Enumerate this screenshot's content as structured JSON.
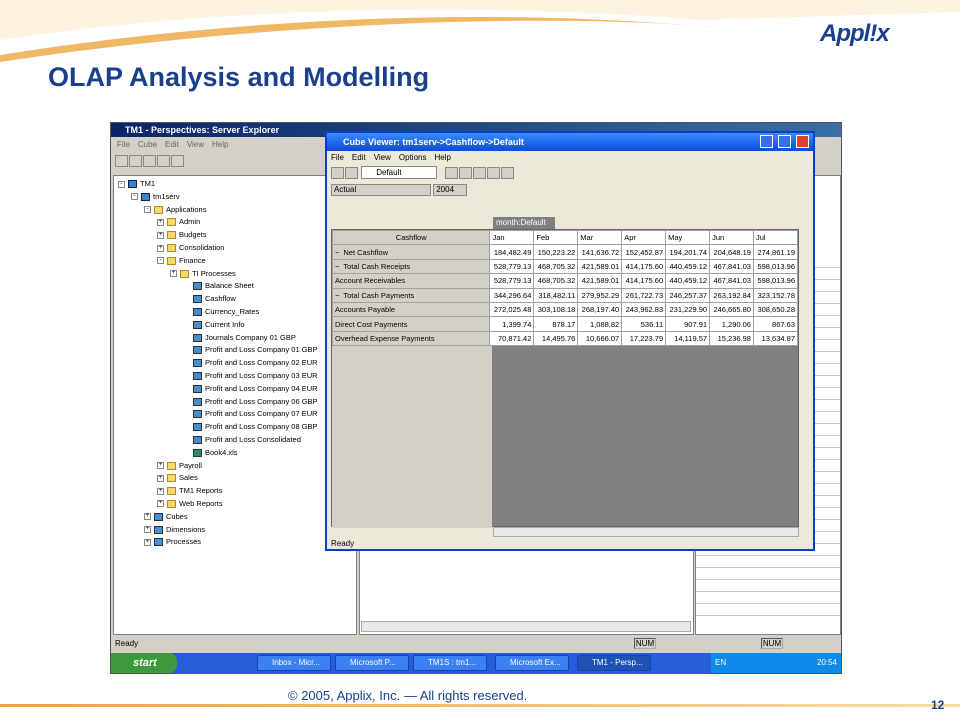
{
  "slide": {
    "title": "OLAP Analysis and Modelling",
    "logo": "Appl!x",
    "copyright": "© 2005, Applix, Inc. — All rights reserved.",
    "page": "12"
  },
  "explorer": {
    "title": "TM1 - Perspectives: Server Explorer",
    "menu": [
      "File",
      "Cube",
      "Edit",
      "View",
      "Help"
    ],
    "tree": [
      {
        "t": "TM1",
        "d": 0,
        "pm": "-",
        "ic": "srv"
      },
      {
        "t": "tm1serv",
        "d": 1,
        "pm": "-",
        "ic": "srv"
      },
      {
        "t": "Applications",
        "d": 2,
        "pm": "-",
        "ic": "folder"
      },
      {
        "t": "Admin",
        "d": 3,
        "pm": "+",
        "ic": "folder"
      },
      {
        "t": "Budgets",
        "d": 3,
        "pm": "+",
        "ic": "folder"
      },
      {
        "t": "Consolidation",
        "d": 3,
        "pm": "+",
        "ic": "folder"
      },
      {
        "t": "Finance",
        "d": 3,
        "pm": "-",
        "ic": "folder"
      },
      {
        "t": "TI Processes",
        "d": 4,
        "pm": "+",
        "ic": "folder"
      },
      {
        "t": "Balance Sheet",
        "d": 5,
        "pm": "",
        "ic": "cubei"
      },
      {
        "t": "Cashflow",
        "d": 5,
        "pm": "",
        "ic": "cubei"
      },
      {
        "t": "Currency_Rates",
        "d": 5,
        "pm": "",
        "ic": "cubei"
      },
      {
        "t": "Current Info",
        "d": 5,
        "pm": "",
        "ic": "cubei"
      },
      {
        "t": "Journals Company 01 GBP",
        "d": 5,
        "pm": "",
        "ic": "cubei"
      },
      {
        "t": "Profit and Loss Company 01 GBP",
        "d": 5,
        "pm": "",
        "ic": "cubei"
      },
      {
        "t": "Profit and Loss Company 02 EUR",
        "d": 5,
        "pm": "",
        "ic": "cubei"
      },
      {
        "t": "Profit and Loss Company 03 EUR",
        "d": 5,
        "pm": "",
        "ic": "cubei"
      },
      {
        "t": "Profit and Loss Company 04 EUR",
        "d": 5,
        "pm": "",
        "ic": "cubei"
      },
      {
        "t": "Profit and Loss Company 06 GBP",
        "d": 5,
        "pm": "",
        "ic": "cubei"
      },
      {
        "t": "Profit and Loss Company 07 EUR",
        "d": 5,
        "pm": "",
        "ic": "cubei"
      },
      {
        "t": "Profit and Loss Company 08 GBP",
        "d": 5,
        "pm": "",
        "ic": "cubei"
      },
      {
        "t": "Profit and Loss Consolidated",
        "d": 5,
        "pm": "",
        "ic": "cubei"
      },
      {
        "t": "Book4.xls",
        "d": 5,
        "pm": "",
        "ic": "xls"
      },
      {
        "t": "Payroll",
        "d": 3,
        "pm": "+",
        "ic": "folder"
      },
      {
        "t": "Sales",
        "d": 3,
        "pm": "+",
        "ic": "folder"
      },
      {
        "t": "TM1 Reports",
        "d": 3,
        "pm": "+",
        "ic": "folder"
      },
      {
        "t": "Web Reports",
        "d": 3,
        "pm": "+",
        "ic": "folder"
      },
      {
        "t": "Cubes",
        "d": 2,
        "pm": "+",
        "ic": "cubei"
      },
      {
        "t": "Dimensions",
        "d": 2,
        "pm": "+",
        "ic": "cubei"
      },
      {
        "t": "Processes",
        "d": 2,
        "pm": "+",
        "ic": "cubei"
      }
    ],
    "status": "Ready",
    "num": "NUM"
  },
  "viewer": {
    "title": "Cube Viewer:  tm1serv->Cashflow->Default",
    "menu": [
      "File",
      "Edit",
      "View",
      "Options",
      "Help"
    ],
    "view": "Default",
    "title_dims": [
      "Actual",
      "2004"
    ],
    "col_dim": "month:Default",
    "row_dim": "Cashflow",
    "months": [
      "Jan",
      "Feb",
      "Mar",
      "Apr",
      "May",
      "Jun",
      "Jul"
    ],
    "rows": [
      {
        "label": "Net Cashflow",
        "exp": "−",
        "v": [
          "184,482.49",
          "150,223.22",
          "141,636.72",
          "152,452.87",
          "194,201.74",
          "204,648.19",
          "274,861.19"
        ]
      },
      {
        "label": "Total Cash Receipts",
        "exp": "−",
        "v": [
          "528,779.13",
          "468,705.32",
          "421,589.01",
          "414,175.60",
          "440,459.12",
          "467,841.03",
          "598,013.96"
        ]
      },
      {
        "label": "Account Receivables",
        "exp": "",
        "v": [
          "528,779.13",
          "468,705.32",
          "421,589.01",
          "414,175.60",
          "440,459.12",
          "467,841.03",
          "598,013.96"
        ]
      },
      {
        "label": "Total Cash Payments",
        "exp": "−",
        "v": [
          "344,296.64",
          "318,482.11",
          "279,952.29",
          "261,722.73",
          "246,257.37",
          "263,192.84",
          "323,152.78"
        ]
      },
      {
        "label": "Accounts Payable",
        "exp": "",
        "v": [
          "272,025.48",
          "303,108.18",
          "268,197.40",
          "243,962.83",
          "231,229.90",
          "246,665.80",
          "308,650.28"
        ]
      },
      {
        "label": "Direct Cost Payments",
        "exp": "",
        "v": [
          "1,399.74",
          "878.17",
          "1,088.82",
          "536.11",
          "907.91",
          "1,290.06",
          "867.63"
        ]
      },
      {
        "label": "Overhead Expense Payments",
        "exp": "",
        "v": [
          "70,871.42",
          "14,495.76",
          "10,666.07",
          "17,223.79",
          "14,119.57",
          "15,236.98",
          "13,634.87"
        ]
      }
    ],
    "status": "Ready"
  },
  "taskbar": {
    "start": "start",
    "tasks": [
      "Inbox - Micr...",
      "Microsoft P...",
      "TM1S : tm1...",
      "Microsoft Ex...",
      "TM1 - Persp..."
    ],
    "lang": "EN",
    "time": "20:54"
  }
}
